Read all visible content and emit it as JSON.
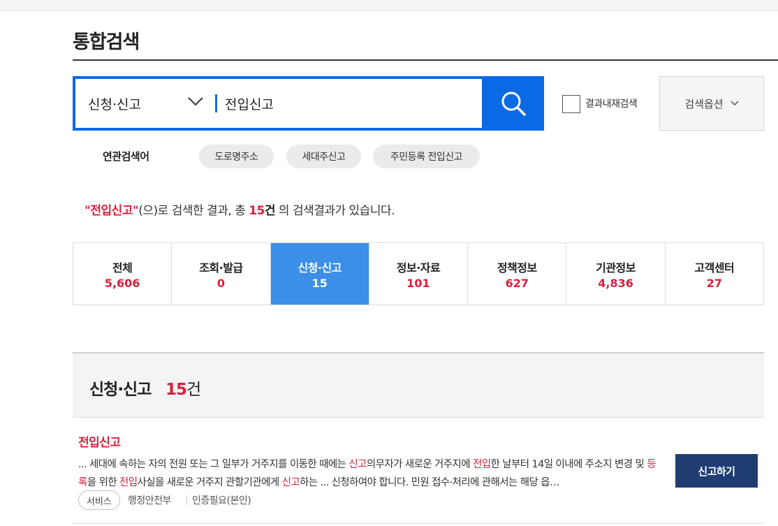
{
  "header": {
    "title": "통합검색"
  },
  "search": {
    "category": "신청·신고",
    "query": "전입신고",
    "button_icon": "search-icon",
    "research_label": "결과내재검색",
    "options_label": "검색옵션"
  },
  "related": {
    "label": "연관검색어",
    "chips": [
      "도로명주소",
      "세대주신고",
      "주민등록 전입신고"
    ]
  },
  "summary": {
    "quote_open": "\"",
    "keyword": "전입신고",
    "quote_close": "\"",
    "text_before": "(으)로 검색한 결과, 총 ",
    "count": "15",
    "unit": "건",
    "text_after": " 의 검색결과가 있습니다."
  },
  "tabs": [
    {
      "label": "전체",
      "count": "5,606"
    },
    {
      "label": "조회·발급",
      "count": "0"
    },
    {
      "label": "신청·신고",
      "count": "15",
      "active": true
    },
    {
      "label": "정보·자료",
      "count": "101"
    },
    {
      "label": "정책정보",
      "count": "627"
    },
    {
      "label": "기관정보",
      "count": "4,836"
    },
    {
      "label": "고객센터",
      "count": "27"
    }
  ],
  "section": {
    "title": "신청·신고",
    "count": "15",
    "unit": "건"
  },
  "result": {
    "title": "전입신고",
    "desc_parts": [
      {
        "t": "... 세대에 속하는 자의 전원 또는 그 일부가 거주지를 이동한 때에는 "
      },
      {
        "t": "신고",
        "hl": true
      },
      {
        "t": "의무자가 새로운 거주지에 "
      },
      {
        "t": "전입",
        "hl": true
      },
      {
        "t": "한 날부터 14일 이내에 주소지 변경 및 "
      },
      {
        "t": "등록",
        "hl": true
      },
      {
        "t": "을 위한 "
      },
      {
        "t": "전입",
        "hl": true
      },
      {
        "t": "사실을 새로운 거주지 관할기관에게 "
      },
      {
        "t": "신고",
        "hl": true
      },
      {
        "t": "하는 ... 신청하여야 합니다. 민원 접수·처리에 관해서는 해당 읍…"
      }
    ],
    "tag": "서비스",
    "agency": "행정안전부",
    "auth": "인증필요(본인)",
    "action": "신고하기"
  },
  "colors": {
    "accent": "#0a6ae6",
    "active_tab": "#3b8fe6",
    "highlight": "#d7213c",
    "button_dark": "#1f3d73"
  }
}
